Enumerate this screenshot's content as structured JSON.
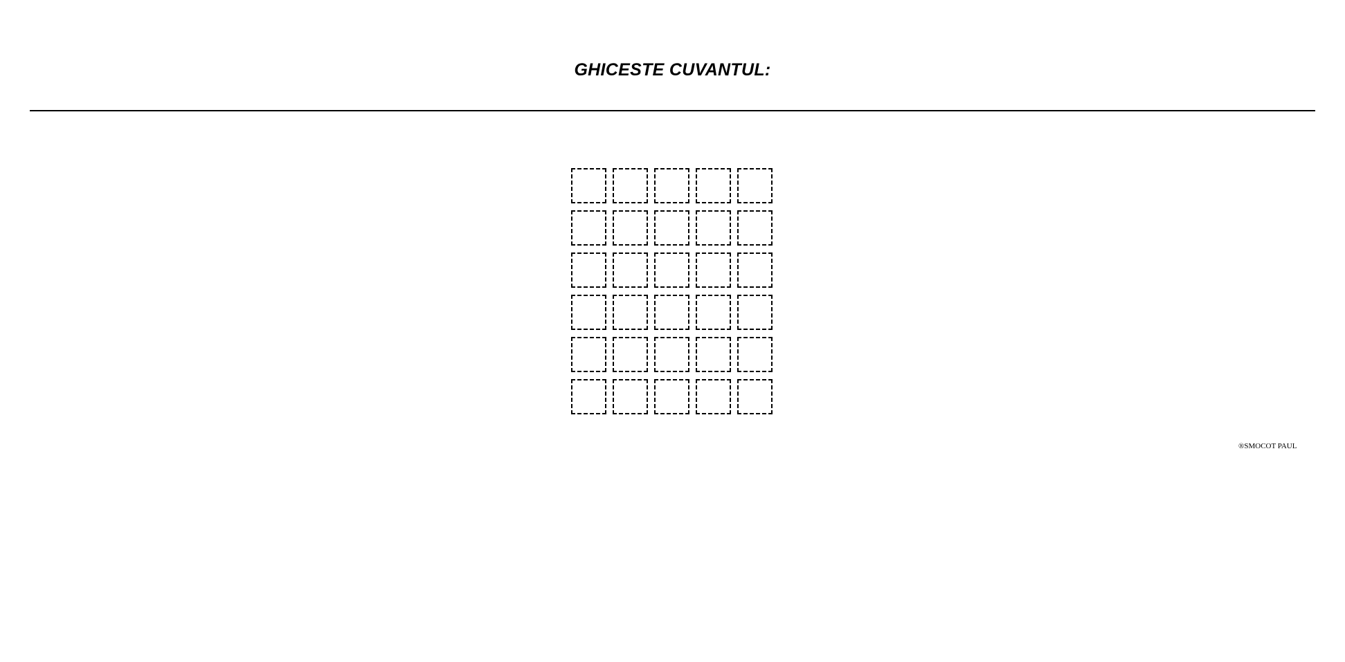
{
  "header": {
    "title": "GHICESTE CUVANTUL:"
  },
  "board": {
    "rows": [
      [
        "",
        "",
        "",
        "",
        ""
      ],
      [
        "",
        "",
        "",
        "",
        ""
      ],
      [
        "",
        "",
        "",
        "",
        ""
      ],
      [
        "",
        "",
        "",
        "",
        ""
      ],
      [
        "",
        "",
        "",
        "",
        ""
      ],
      [
        "",
        "",
        "",
        "",
        ""
      ]
    ]
  },
  "footer": {
    "credit": "®SMOCOT PAUL"
  },
  "colors": {
    "background": "#ffffff",
    "ink": "#000000"
  }
}
